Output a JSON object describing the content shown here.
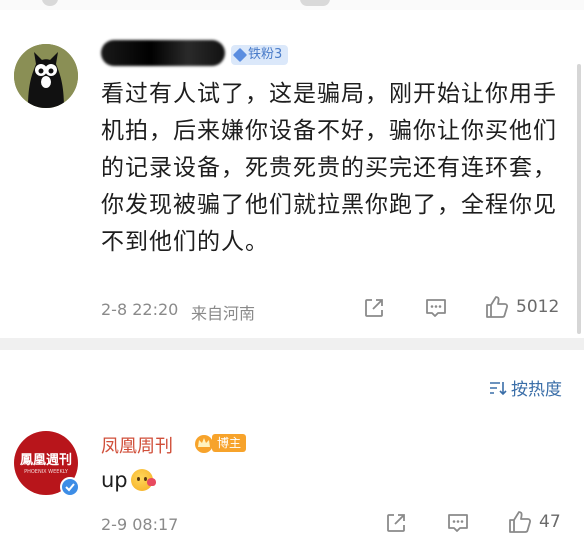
{
  "comment": {
    "username": "",
    "fan_badge": "铁粉3",
    "text": "看过有人试了，这是骗局，刚开始让你用手机拍，后来嫌你设备不好，骗你让你买他们的记录设备，死贵死贵的买完还有连环套，你发现被骗了他们就拉黑你跑了，全程你见不到他们的人。",
    "timestamp": "2-8 22:20",
    "location": "来自河南",
    "like_count": "5012",
    "icons": [
      "share-icon",
      "comment-icon",
      "like-icon"
    ]
  },
  "sort": {
    "label": "按热度",
    "icon": "sort-icon"
  },
  "reply": {
    "author": "凤凰周刊",
    "author_badge": "博主",
    "avatar_logo_text": "鳳凰週刊",
    "avatar_logo_sub": "PHOENIX WEEKLY",
    "text": "up",
    "emoji": "kiss-face-emoji",
    "timestamp": "2-9 08:17",
    "like_count": "47",
    "icons": [
      "share-icon",
      "comment-icon",
      "like-icon"
    ]
  },
  "colors": {
    "author_name": "#d04f3a",
    "sort_link": "#3a6ea8",
    "fan_badge_bg": "#dbe8fa",
    "host_badge_bg": "#f7a32b",
    "avatar2_bg": "#b8151b",
    "verified_blue": "#3d8de6"
  }
}
